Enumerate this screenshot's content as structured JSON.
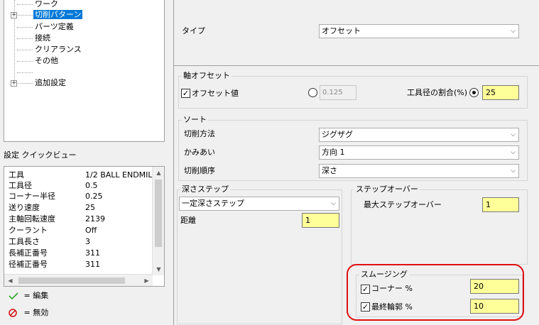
{
  "tree": {
    "items": [
      {
        "label": "ワーク"
      },
      {
        "label": "切削パターン"
      },
      {
        "label": "パーツ定義"
      },
      {
        "label": "接続"
      },
      {
        "label": "クリアランス"
      },
      {
        "label": "その他"
      },
      {
        "label": "追加設定"
      }
    ]
  },
  "quickview": {
    "title": "設定 クイックビュー",
    "rows": [
      {
        "key": "工具",
        "value": "1/2 BALL ENDMILL"
      },
      {
        "key": "工具径",
        "value": "0.5"
      },
      {
        "key": "コーナー半径",
        "value": "0.25"
      },
      {
        "key": "送り速度",
        "value": "25"
      },
      {
        "key": "主軸回転速度",
        "value": "2139"
      },
      {
        "key": "クーラント",
        "value": "Off"
      },
      {
        "key": "工具長さ",
        "value": "3"
      },
      {
        "key": "長補正番号",
        "value": "311"
      },
      {
        "key": "径補正番号",
        "value": "311"
      }
    ]
  },
  "legend": {
    "edit": "= 編集",
    "disabled": "= 無効",
    "edit_color": "#2eaa2e",
    "disabled_color": "#d01010"
  },
  "type": {
    "label": "タイプ",
    "value": "オフセット"
  },
  "axis_offset": {
    "title": "軸オフセット",
    "offset_value_label": "オフセット値",
    "offset_value_checked": true,
    "value_field": "0.125",
    "ratio_label": "工具径の割合(%)",
    "ratio_value": "25",
    "ratio_selected": true
  },
  "sort": {
    "title": "ソート",
    "cut_method_label": "切削方法",
    "cut_method_value": "ジグザグ",
    "engagement_label": "かみあい",
    "engagement_value": "方向 1",
    "cut_order_label": "切削順序",
    "cut_order_value": "深さ"
  },
  "depth_step": {
    "title": "深さステップ",
    "mode_value": "一定深さステップ",
    "distance_label": "距離",
    "distance_value": "1"
  },
  "stepover": {
    "title": "ステップオーバー",
    "max_label": "最大ステップオーバー",
    "max_value": "1"
  },
  "smoothing": {
    "title": "スムージング",
    "corner_label": "コーナー %",
    "corner_checked": true,
    "corner_value": "20",
    "final_label": "最終輪郭 %",
    "final_checked": true,
    "final_value": "10",
    "highlight_color": "#e01010"
  },
  "field_color": "#ffff99"
}
